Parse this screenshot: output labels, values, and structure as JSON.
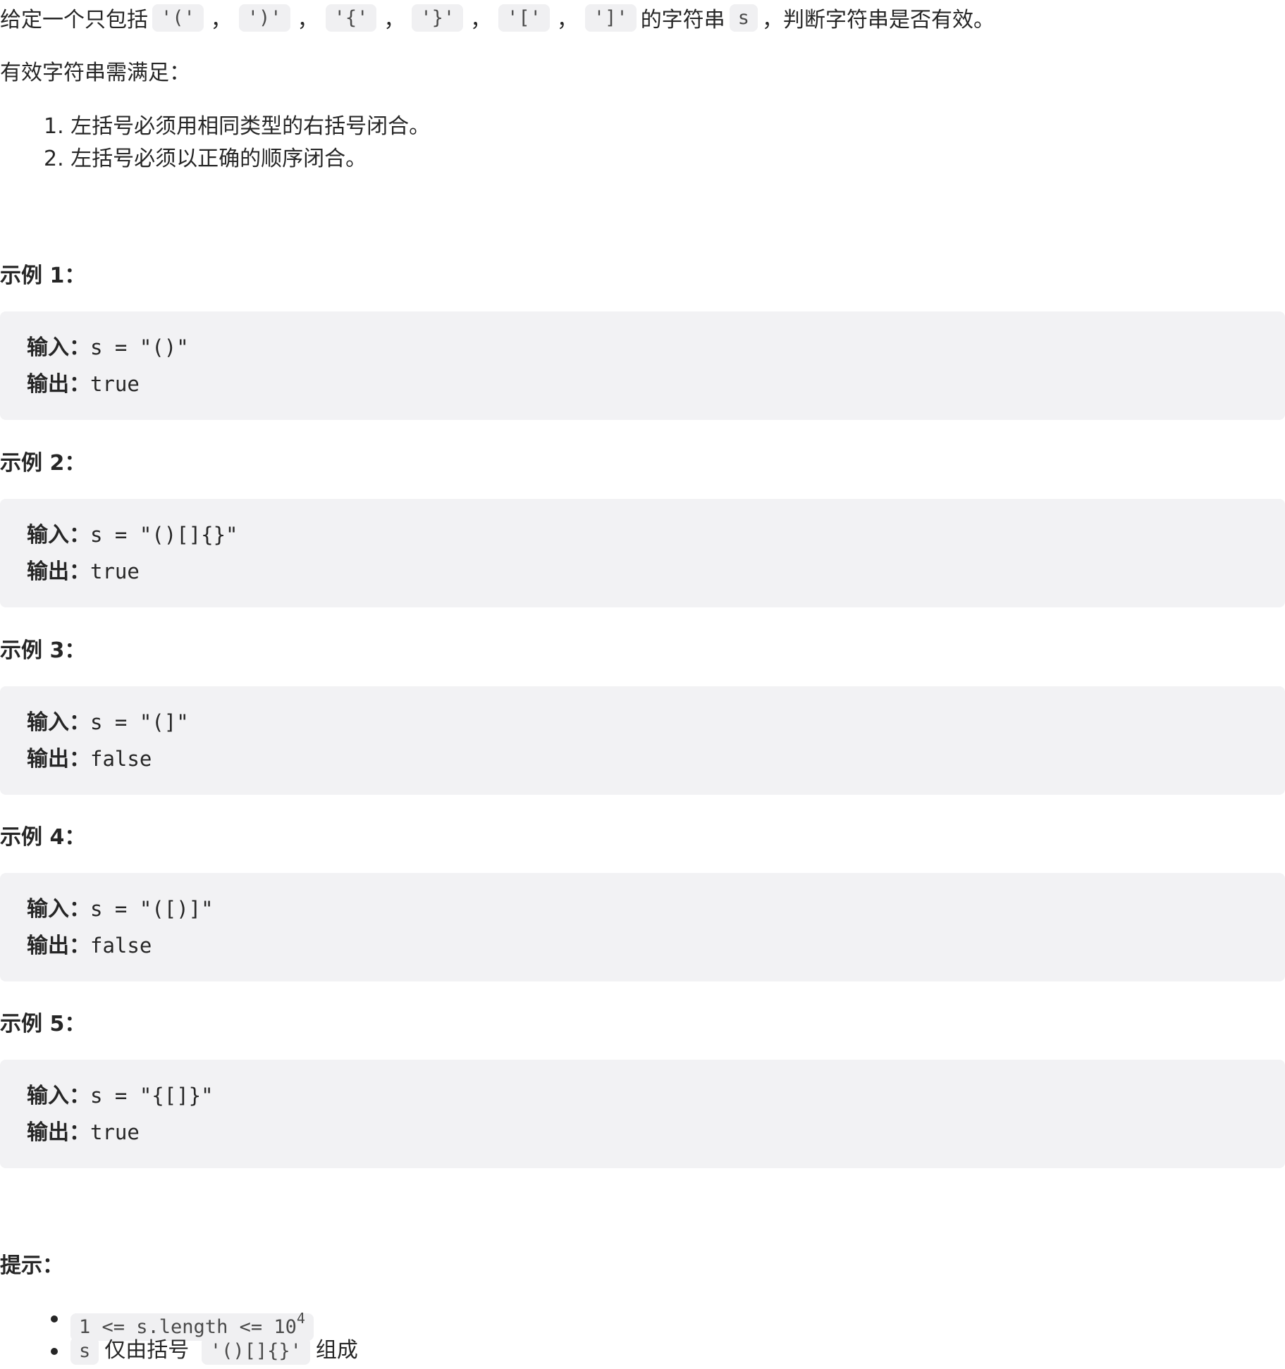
{
  "intro": {
    "prefix": "给定一个只包括",
    "chars": [
      "'('",
      "')'",
      "'{'",
      "'}'",
      "'['",
      "']'"
    ],
    "separator": "，",
    "middle": "的字符串",
    "var": "s",
    "suffix": "，判断字符串是否有效。"
  },
  "requirements": {
    "title": "有效字符串需满足：",
    "items": [
      "1. 左括号必须用相同类型的右括号闭合。",
      "2. 左括号必须以正确的顺序闭合。"
    ]
  },
  "examples": [
    {
      "title": "示例 1：",
      "input_label": "输入：",
      "input": "s = \"()\"",
      "output_label": "输出：",
      "output": "true"
    },
    {
      "title": "示例 2：",
      "input_label": "输入：",
      "input": "s = \"()[]{}\"",
      "output_label": "输出：",
      "output": "true"
    },
    {
      "title": "示例 3：",
      "input_label": "输入：",
      "input": "s = \"(]\"",
      "output_label": "输出：",
      "output": "false"
    },
    {
      "title": "示例 4：",
      "input_label": "输入：",
      "input": "s = \"([)]\"",
      "output_label": "输出：",
      "output": "false"
    },
    {
      "title": "示例 5：",
      "input_label": "输入：",
      "input": "s = \"{[]}\"",
      "output_label": "输出：",
      "output": "true"
    }
  ],
  "hints": {
    "title": "提示：",
    "items": [
      {
        "code": "1 <= s.length <= 10",
        "sup": "4"
      },
      {
        "code": "s",
        "text": "仅由括号",
        "code2": "'()[]{}'",
        "text2": "组成"
      }
    ]
  }
}
